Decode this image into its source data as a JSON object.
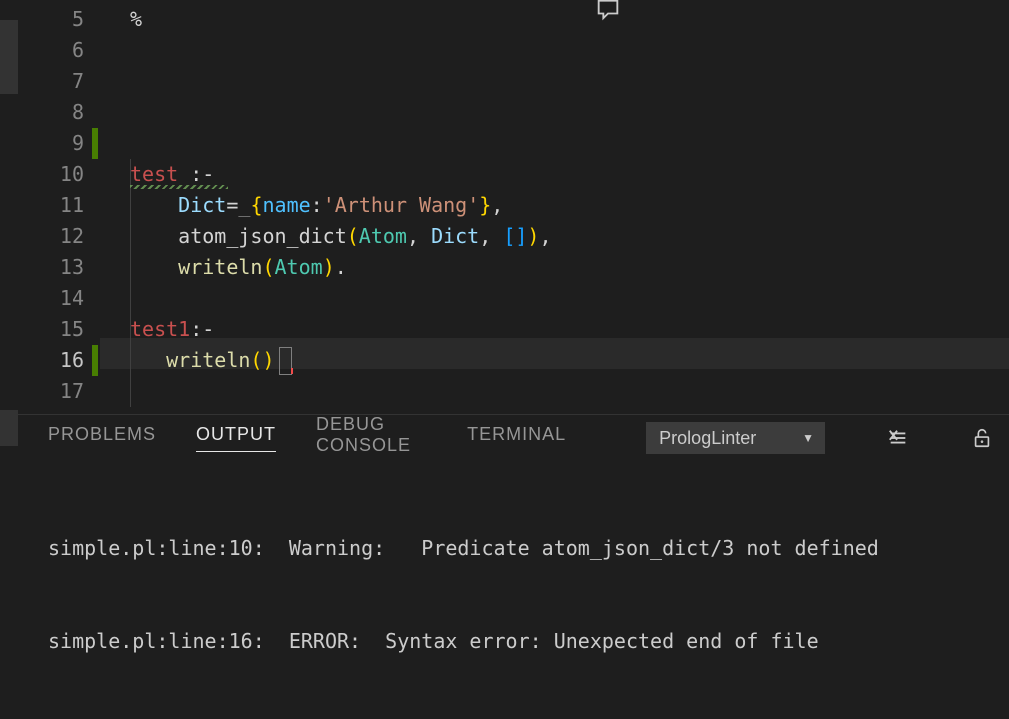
{
  "editor": {
    "line_numbers": [
      "5",
      "6",
      "7",
      "8",
      "9",
      "10",
      "11",
      "12",
      "13",
      "14",
      "15",
      "16",
      "17"
    ],
    "active_line_index": 11,
    "l5": "%",
    "l10": {
      "a": "test",
      "b": " :-"
    },
    "l11": {
      "dict": "Dict",
      "eq": "=",
      "us": "_",
      "lb": "{",
      "name": "name",
      "colon": ":",
      "str": "'Arthur Wang'",
      "rb": "}",
      "comma": ","
    },
    "l12": {
      "fn": "atom_json_dict",
      "lp": "(",
      "a1": "Atom",
      "c1": ", ",
      "a2": "Dict",
      "c2": ", ",
      "lbr": "[",
      "rbr": "]",
      "rp": ")",
      "comma": ","
    },
    "l13": {
      "fn": "writeln",
      "lp": "(",
      "a": "Atom",
      "rp": ")",
      "dot": "."
    },
    "l15": {
      "a": "test1",
      "b": ":-"
    },
    "l16": {
      "fn": "writeln",
      "lp": "(",
      "rp": ")"
    }
  },
  "panel": {
    "tabs": {
      "problems": "PROBLEMS",
      "output": "OUTPUT",
      "debug": "DEBUG CONSOLE",
      "terminal": "TERMINAL"
    },
    "active_tab": "OUTPUT",
    "dropdown_value": "PrologLinter",
    "output_lines": [
      "simple.pl:line:10:  Warning:   Predicate atom_json_dict/3 not defined",
      "simple.pl:line:16:  ERROR:  Syntax error: Unexpected end of file"
    ]
  }
}
